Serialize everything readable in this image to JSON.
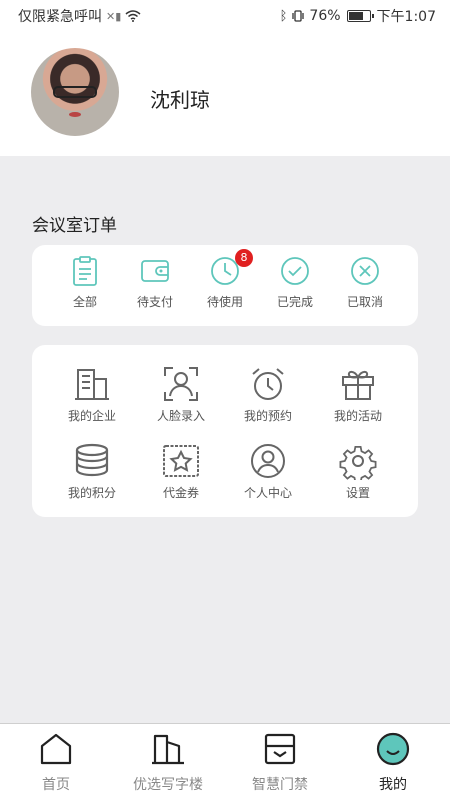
{
  "status_bar": {
    "carrier": "仅限紧急呼叫",
    "battery_percent": "76%",
    "battery_level": 0.76,
    "time": "下午1:07"
  },
  "profile": {
    "name": "沈利琼"
  },
  "orders": {
    "title": "会议室订单",
    "accent_color": "#5ec6bb",
    "badge_color": "#e02020",
    "items": [
      {
        "label": "全部",
        "icon": "clipboard-icon"
      },
      {
        "label": "待支付",
        "icon": "wallet-icon"
      },
      {
        "label": "待使用",
        "icon": "clock-icon",
        "badge": "8"
      },
      {
        "label": "已完成",
        "icon": "check-circle-icon"
      },
      {
        "label": "已取消",
        "icon": "x-circle-icon"
      }
    ]
  },
  "menu": {
    "items": [
      {
        "label": "我的企业",
        "icon": "building-icon"
      },
      {
        "label": "人脸录入",
        "icon": "face-scan-icon"
      },
      {
        "label": "我的预约",
        "icon": "alarm-clock-icon"
      },
      {
        "label": "我的活动",
        "icon": "gift-icon"
      },
      {
        "label": "我的积分",
        "icon": "coins-icon"
      },
      {
        "label": "代金券",
        "icon": "voucher-icon"
      },
      {
        "label": "个人中心",
        "icon": "person-circle-icon"
      },
      {
        "label": "设置",
        "icon": "settings-gear-icon"
      }
    ]
  },
  "tabbar": {
    "items": [
      {
        "label": "首页",
        "icon": "home-icon",
        "active": false
      },
      {
        "label": "优选写字楼",
        "icon": "office-building-icon",
        "active": false
      },
      {
        "label": "智慧门禁",
        "icon": "door-access-icon",
        "active": false
      },
      {
        "label": "我的",
        "icon": "profile-face-icon",
        "active": true
      }
    ]
  }
}
